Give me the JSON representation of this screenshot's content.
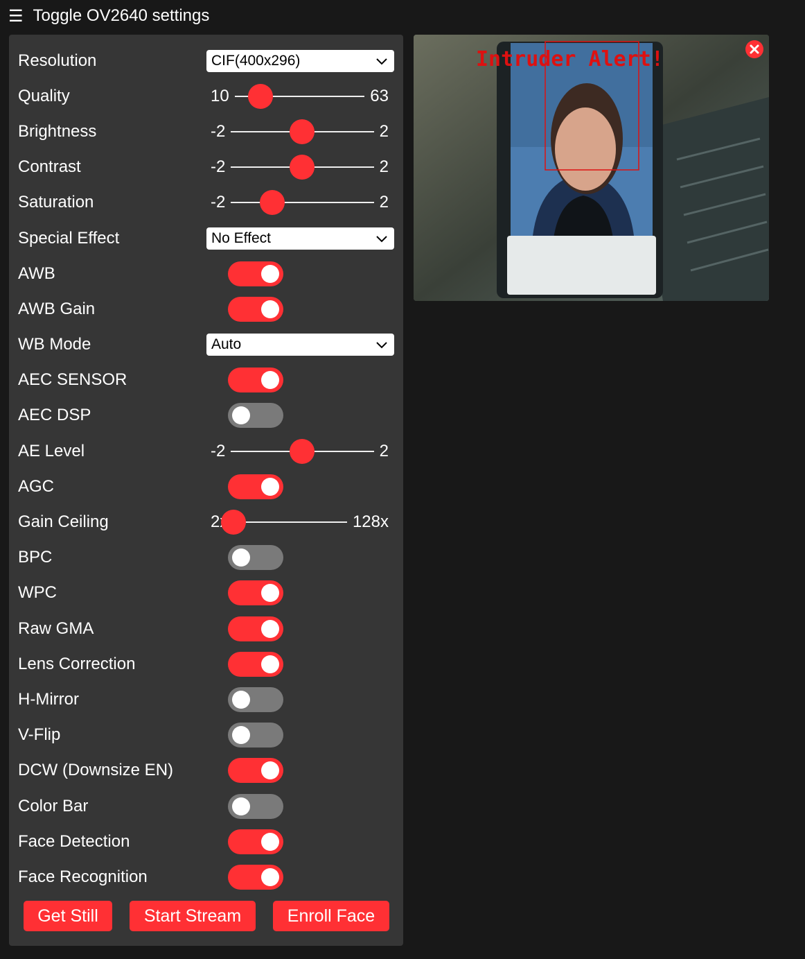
{
  "header": {
    "menu_icon": "hamburger-icon",
    "menu_glyph": "☰",
    "title": "Toggle OV2640 settings"
  },
  "settings": {
    "resolution": {
      "label": "Resolution",
      "value": "CIF(400x296)"
    },
    "quality": {
      "label": "Quality",
      "min": "10",
      "max": "63",
      "level": 0.2
    },
    "brightness": {
      "label": "Brightness",
      "min": "-2",
      "max": "2",
      "level": 0.5
    },
    "contrast": {
      "label": "Contrast",
      "min": "-2",
      "max": "2",
      "level": 0.5
    },
    "saturation": {
      "label": "Saturation",
      "min": "-2",
      "max": "2",
      "level": 0.29
    },
    "special_effect": {
      "label": "Special Effect",
      "value": "No Effect"
    },
    "awb": {
      "label": "AWB",
      "on": true
    },
    "awb_gain": {
      "label": "AWB Gain",
      "on": true
    },
    "wb_mode": {
      "label": "WB Mode",
      "value": "Auto"
    },
    "aec_sensor": {
      "label": "AEC SENSOR",
      "on": true
    },
    "aec_dsp": {
      "label": "AEC DSP",
      "on": false
    },
    "ae_level": {
      "label": "AE Level",
      "min": "-2",
      "max": "2",
      "level": 0.5
    },
    "agc": {
      "label": "AGC",
      "on": true
    },
    "gain_ceiling": {
      "label": "Gain Ceiling",
      "min": "2x",
      "max": "128x",
      "level": 0.0
    },
    "bpc": {
      "label": "BPC",
      "on": false
    },
    "wpc": {
      "label": "WPC",
      "on": true
    },
    "raw_gma": {
      "label": "Raw GMA",
      "on": true
    },
    "lens_correction": {
      "label": "Lens Correction",
      "on": true
    },
    "hmirror": {
      "label": "H-Mirror",
      "on": false
    },
    "vflip": {
      "label": "V-Flip",
      "on": false
    },
    "dcw": {
      "label": "DCW (Downsize EN)",
      "on": true
    },
    "colorbar": {
      "label": "Color Bar",
      "on": false
    },
    "face_detect": {
      "label": "Face Detection",
      "on": true
    },
    "face_recognize": {
      "label": "Face Recognition",
      "on": true
    }
  },
  "buttons": {
    "get_still": "Get Still",
    "start_stream": "Start Stream",
    "enroll_face": "Enroll Face"
  },
  "viewer": {
    "overlay_text": "Intruder Alert!",
    "close_icon": "close-icon"
  },
  "colors": {
    "accent": "#ff3034",
    "panel": "#363636",
    "background": "#181818",
    "toggle_off": "#7a7a7a"
  }
}
